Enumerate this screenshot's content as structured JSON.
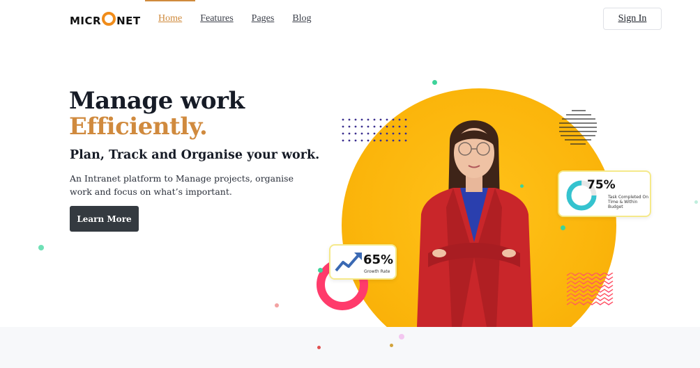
{
  "brand": {
    "logo_left": "MICR",
    "logo_right": "NET",
    "accent": "#f08c1a"
  },
  "nav": {
    "items": [
      {
        "label": "Home",
        "active": true
      },
      {
        "label": "Features",
        "active": false
      },
      {
        "label": "Pages",
        "active": false
      },
      {
        "label": "Blog",
        "active": false
      }
    ],
    "active_color": "#cf8a3c"
  },
  "header": {
    "signin_label": "Sign In"
  },
  "hero": {
    "headline": "Manage work",
    "headline_accent": "Efficiently.",
    "subheading": "Plan, Track and Organise your work.",
    "description": "An Intranet platform to Manage projects, organise work and focus on what’s important.",
    "cta_label": "Learn More",
    "cta_color": "#343a40"
  },
  "stats": {
    "task": {
      "value": "75%",
      "label": "Task Completed On Time & Within Budget"
    },
    "growth": {
      "value": "65%",
      "label": "Growth Rate"
    }
  },
  "icons": [
    "logo-ring-icon",
    "dot-grid-icon",
    "lines-icon",
    "donut-chart-icon",
    "trend-arrow-icon",
    "ring-icon",
    "zigzag-icon"
  ],
  "colors": {
    "sun": "#fbb50b",
    "donut_75": "#35c3cf",
    "ring": "#ff3b6b",
    "jacket": "#c9262a"
  }
}
